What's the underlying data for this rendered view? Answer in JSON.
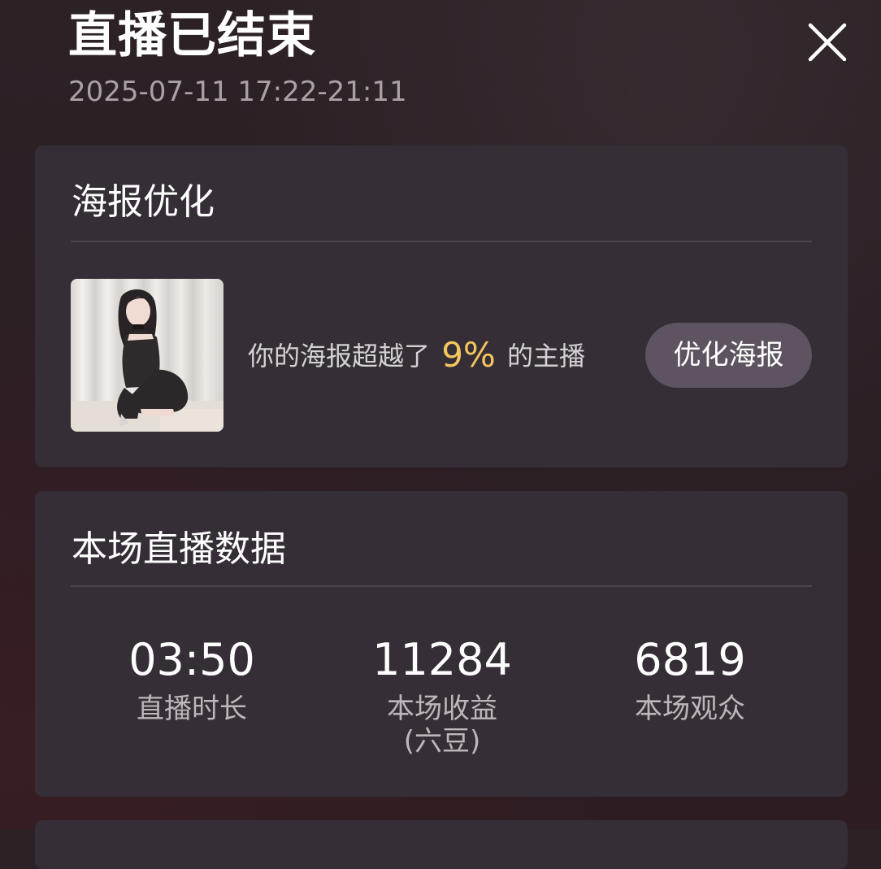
{
  "header": {
    "title": "直播已结束",
    "time_range": "2025-07-11 17:22-21:11"
  },
  "poster_section": {
    "title": "海报优化",
    "text_before": "你的海报超越了",
    "percent": "9%",
    "text_after": "的主播",
    "optimize_button": "优化海报"
  },
  "data_section": {
    "title": "本场直播数据",
    "stats": [
      {
        "value": "03:50",
        "label": "直播时长"
      },
      {
        "value": "11284",
        "label": "本场收益",
        "sub_label": "(六豆)"
      },
      {
        "value": "6819",
        "label": "本场观众"
      }
    ]
  },
  "icons": {
    "close": "close-icon",
    "thumbnail": "poster-thumbnail-image"
  },
  "colors": {
    "accent_percent": "#f3c65e",
    "card_bg": "#362e37",
    "button_bg": "#5e5461"
  }
}
